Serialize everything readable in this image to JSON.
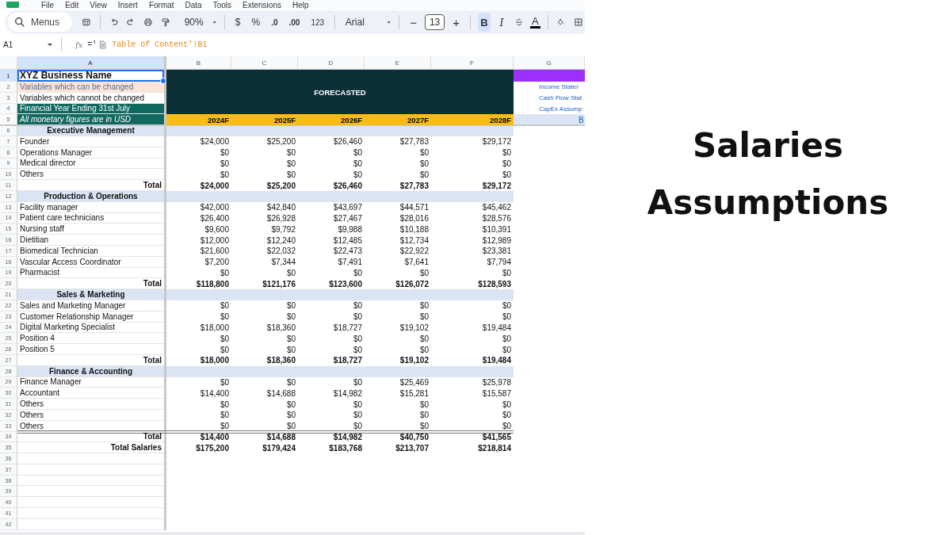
{
  "menu_bar": [
    "File",
    "Edit",
    "View",
    "Insert",
    "Format",
    "Data",
    "Tools",
    "Extensions",
    "Help"
  ],
  "toolbar": {
    "search": "Menus",
    "zoom": "90%",
    "currency": "$",
    "percent": "%",
    "decrease_decimal": ".0",
    "increase_decimal": ".00",
    "number_format": "123",
    "font": "Arial",
    "font_size": "13",
    "minus": "−",
    "plus": "+",
    "bold": {
      "label": "B",
      "selected": true
    },
    "italic": {
      "label": "I",
      "selected": false
    },
    "text_color": {
      "label": "A",
      "color": "#000000"
    }
  },
  "formula_bar": {
    "cell": "A1",
    "fx": "fx",
    "prefix": "='",
    "formula": "Table of Content'!B1"
  },
  "columns": [
    {
      "label": "A",
      "selected": true
    },
    {
      "label": "B",
      "selected": false
    },
    {
      "label": "C",
      "selected": false
    },
    {
      "label": "D",
      "selected": false
    },
    {
      "label": "E",
      "selected": false
    },
    {
      "label": "F",
      "selected": false
    },
    {
      "label": "G",
      "selected": false
    }
  ],
  "forecast_header": {
    "title": "FORECASTED",
    "years": [
      "2024F",
      "2025F",
      "2026F",
      "2027F",
      "2028F"
    ]
  },
  "side_links": [
    "Income Stater",
    "Cash Flow Stat",
    "CapEx Assump",
    "B"
  ],
  "rows": [
    {
      "number": "1",
      "selected": true,
      "kind": "title",
      "label": "XYZ Business Name"
    },
    {
      "number": "2",
      "selected": false,
      "kind": "changeable",
      "label": "Variables which can be changed"
    },
    {
      "number": "3",
      "selected": false,
      "kind": "fixed",
      "label": "Variables which cannot be changed"
    },
    {
      "number": "4",
      "selected": false,
      "kind": "dark",
      "label": "Financial Year Ending 31st July"
    },
    {
      "number": "5",
      "selected": false,
      "kind": "dark_italic",
      "label": "All monetary figures are in USD"
    },
    {
      "number": "6",
      "selected": false,
      "kind": "section",
      "label": "Executive Management"
    },
    {
      "number": "7",
      "selected": false,
      "kind": "item",
      "label": "Founder",
      "values": [
        "$24,000",
        "$25,200",
        "$26,460",
        "$27,783",
        "$29,172"
      ]
    },
    {
      "number": "8",
      "selected": false,
      "kind": "item",
      "label": "Operations Manager",
      "values": [
        "$0",
        "$0",
        "$0",
        "$0",
        "$0"
      ]
    },
    {
      "number": "9",
      "selected": false,
      "kind": "item",
      "label": "Medical director",
      "values": [
        "$0",
        "$0",
        "$0",
        "$0",
        "$0"
      ]
    },
    {
      "number": "10",
      "selected": false,
      "kind": "item",
      "label": "Others",
      "values": [
        "$0",
        "$0",
        "$0",
        "$0",
        "$0"
      ]
    },
    {
      "number": "11",
      "selected": false,
      "kind": "total",
      "label": "Total",
      "values": [
        "$24,000",
        "$25,200",
        "$26,460",
        "$27,783",
        "$29,172"
      ]
    },
    {
      "number": "12",
      "selected": false,
      "kind": "section",
      "label": "Production & Operations"
    },
    {
      "number": "13",
      "selected": false,
      "kind": "item",
      "label": "Facility manager",
      "values": [
        "$42,000",
        "$42,840",
        "$43,697",
        "$44,571",
        "$45,462"
      ]
    },
    {
      "number": "14",
      "selected": false,
      "kind": "item",
      "label": "Patient care technicians",
      "values": [
        "$26,400",
        "$26,928",
        "$27,467",
        "$28,016",
        "$28,576"
      ]
    },
    {
      "number": "15",
      "selected": false,
      "kind": "item",
      "label": "Nursing staff",
      "values": [
        "$9,600",
        "$9,792",
        "$9,988",
        "$10,188",
        "$10,391"
      ]
    },
    {
      "number": "16",
      "selected": false,
      "kind": "item",
      "label": "Dietitian",
      "values": [
        "$12,000",
        "$12,240",
        "$12,485",
        "$12,734",
        "$12,989"
      ]
    },
    {
      "number": "17",
      "selected": false,
      "kind": "item",
      "label": "Biomedical Technician",
      "values": [
        "$21,600",
        "$22,032",
        "$22,473",
        "$22,922",
        "$23,381"
      ]
    },
    {
      "number": "18",
      "selected": false,
      "kind": "item",
      "label": "Vascular Access Coordinator",
      "values": [
        "$7,200",
        "$7,344",
        "$7,491",
        "$7,641",
        "$7,794"
      ]
    },
    {
      "number": "19",
      "selected": false,
      "kind": "item",
      "label": "Pharmacist",
      "values": [
        "$0",
        "$0",
        "$0",
        "$0",
        "$0"
      ]
    },
    {
      "number": "20",
      "selected": false,
      "kind": "total",
      "label": "Total",
      "values": [
        "$118,800",
        "$121,176",
        "$123,600",
        "$126,072",
        "$128,593"
      ]
    },
    {
      "number": "21",
      "selected": false,
      "kind": "section",
      "label": "Sales & Marketing"
    },
    {
      "number": "22",
      "selected": false,
      "kind": "item",
      "label": "Sales and Marketing Manager",
      "values": [
        "$0",
        "$0",
        "$0",
        "$0",
        "$0"
      ]
    },
    {
      "number": "23",
      "selected": false,
      "kind": "item",
      "label": "Customer Relationship Manager",
      "values": [
        "$0",
        "$0",
        "$0",
        "$0",
        "$0"
      ]
    },
    {
      "number": "24",
      "selected": false,
      "kind": "item",
      "label": "Digital Marketing Specialist",
      "values": [
        "$18,000",
        "$18,360",
        "$18,727",
        "$19,102",
        "$19,484"
      ]
    },
    {
      "number": "25",
      "selected": false,
      "kind": "item",
      "label": "Position 4",
      "values": [
        "$0",
        "$0",
        "$0",
        "$0",
        "$0"
      ]
    },
    {
      "number": "26",
      "selected": false,
      "kind": "item",
      "label": "Position 5",
      "values": [
        "$0",
        "$0",
        "$0",
        "$0",
        "$0"
      ]
    },
    {
      "number": "27",
      "selected": false,
      "kind": "total",
      "label": "Total",
      "values": [
        "$18,000",
        "$18,360",
        "$18,727",
        "$19,102",
        "$19,484"
      ]
    },
    {
      "number": "28",
      "selected": false,
      "kind": "section",
      "label": "Finance & Accounting"
    },
    {
      "number": "29",
      "selected": false,
      "kind": "item",
      "label": "Finance Manager",
      "values": [
        "$0",
        "$0",
        "$0",
        "$25,469",
        "$25,978"
      ]
    },
    {
      "number": "30",
      "selected": false,
      "kind": "item",
      "label": "Accountant",
      "values": [
        "$14,400",
        "$14,688",
        "$14,982",
        "$15,281",
        "$15,587"
      ]
    },
    {
      "number": "31",
      "selected": false,
      "kind": "item",
      "label": "Others",
      "values": [
        "$0",
        "$0",
        "$0",
        "$0",
        "$0"
      ]
    },
    {
      "number": "32",
      "selected": false,
      "kind": "item",
      "label": "Others",
      "values": [
        "$0",
        "$0",
        "$0",
        "$0",
        "$0"
      ]
    },
    {
      "number": "33",
      "selected": false,
      "kind": "item",
      "label": "Others",
      "values": [
        "$0",
        "$0",
        "$0",
        "$0",
        "$0"
      ]
    },
    {
      "number": "34",
      "selected": false,
      "kind": "total",
      "divider_above": true,
      "label": "Total",
      "values": [
        "$14,400",
        "$14,688",
        "$14,982",
        "$40,750",
        "$41,565"
      ]
    },
    {
      "number": "35",
      "selected": false,
      "kind": "grand_total",
      "label": "Total Salaries",
      "values": [
        "$175,200",
        "$179,424",
        "$183,768",
        "$213,707",
        "$218,814"
      ]
    },
    {
      "number": "36",
      "selected": false,
      "kind": "blank"
    },
    {
      "number": "37",
      "selected": false,
      "kind": "blank"
    },
    {
      "number": "38",
      "selected": false,
      "kind": "blank"
    },
    {
      "number": "39",
      "selected": false,
      "kind": "blank"
    },
    {
      "number": "40",
      "selected": false,
      "kind": "blank"
    },
    {
      "number": "41",
      "selected": false,
      "kind": "blank"
    },
    {
      "number": "42",
      "selected": false,
      "kind": "blank"
    }
  ],
  "headline": "Salaries Assumptions"
}
